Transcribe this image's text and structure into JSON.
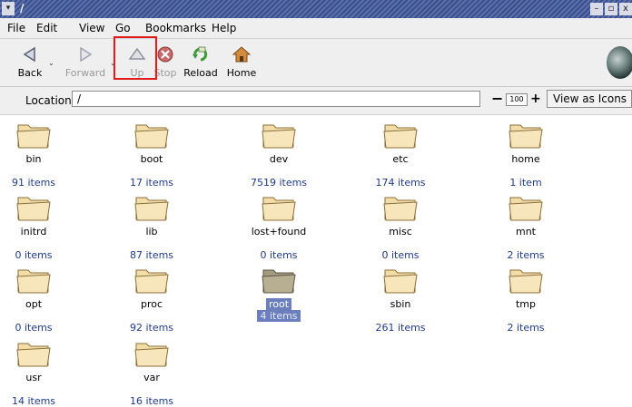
{
  "window": {
    "title": "/",
    "menu_glyph": "▾",
    "minimize_glyph": "–",
    "maximize_glyph": "▫",
    "close_glyph": "x"
  },
  "menubar": [
    {
      "key": "E",
      "rest": "File",
      "display": "File"
    },
    {
      "display": "Edit"
    },
    {
      "display": "View"
    },
    {
      "display": "Go"
    },
    {
      "display": "Bookmarks"
    },
    {
      "display": "Help"
    }
  ],
  "toolbar": {
    "back": {
      "label": "Back",
      "icon": "back-arrow-icon"
    },
    "forward": {
      "label": "Forward",
      "icon": "forward-arrow-icon"
    },
    "up": {
      "label": "Up",
      "icon": "up-arrow-icon"
    },
    "stop": {
      "label": "Stop",
      "icon": "stop-icon"
    },
    "reload": {
      "label": "Reload",
      "icon": "reload-icon"
    },
    "home": {
      "label": "Home",
      "icon": "home-icon"
    },
    "dropdown_glyph": "⌄"
  },
  "location": {
    "label": "Location:",
    "value": "/"
  },
  "zoom": {
    "minus": "−",
    "value": "100",
    "plus": "+"
  },
  "view_as": {
    "label": "View as Icons"
  },
  "folders": [
    {
      "name": "bin",
      "count": "91 items"
    },
    {
      "name": "boot",
      "count": "17 items"
    },
    {
      "name": "dev",
      "count": "7519 items"
    },
    {
      "name": "etc",
      "count": "174 items"
    },
    {
      "name": "home",
      "count": "1 item"
    },
    {
      "name": "initrd",
      "count": "0 items"
    },
    {
      "name": "lib",
      "count": "87 items"
    },
    {
      "name": "lost+found",
      "count": "0 items"
    },
    {
      "name": "misc",
      "count": "0 items"
    },
    {
      "name": "mnt",
      "count": "2 items"
    },
    {
      "name": "opt",
      "count": "0 items"
    },
    {
      "name": "proc",
      "count": "92 items"
    },
    {
      "name": "root",
      "count": "4 items",
      "selected": true
    },
    {
      "name": "sbin",
      "count": "261 items"
    },
    {
      "name": "tmp",
      "count": "2 items"
    },
    {
      "name": "usr",
      "count": "14 items"
    },
    {
      "name": "var",
      "count": "16 items"
    }
  ],
  "colors": {
    "titlebar": "#3b4f88",
    "selection": "#6b7fbf",
    "item_count": "#1f3a8a",
    "highlight": "#e21b1b",
    "folder": "#f3dca6"
  }
}
